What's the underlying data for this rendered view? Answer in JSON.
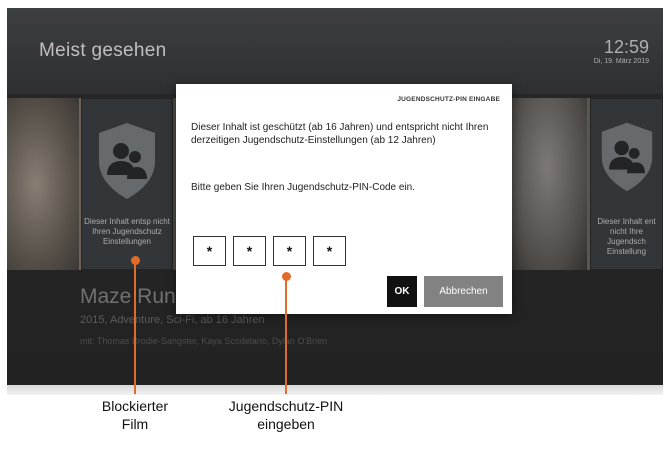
{
  "screen": {
    "page_title": "Meist gesehen",
    "clock_time": "12:59",
    "clock_date": "Di, 19. März 2019"
  },
  "carousel": {
    "left_tile_text": "Dieser Inhalt entsp nicht Ihren Jugendschutz Einstellungen",
    "right_tile_text": "Dieser Inhalt ent nicht Ihre Jugendsch Einstellung",
    "selected_title": "Maze Runner",
    "selected_meta": "2015, Adventure, Sci-Fi, ab 16 Jahren",
    "selected_cast": "mit: Thomas Brodie-Sangster, Kaya Scodelario, Dylan O'Brien"
  },
  "dialog": {
    "title": "JUGENDSCHUTZ-PIN EINGABE",
    "message": "Dieser Inhalt ist geschützt (ab 16 Jahren) und entspricht nicht Ihren derzeitigen Jugendschutz-Einstellungen (ab 12 Jahren)",
    "prompt": "Bitte geben Sie Ihren Jugendschutz-PIN-Code ein.",
    "pin_digits": [
      "*",
      "*",
      "*",
      "*"
    ],
    "ok_label": "OK",
    "cancel_label": "Abbrechen"
  },
  "annotations": {
    "blocked_line1": "Blockierter",
    "blocked_line2": "Film",
    "pin_line1": "Jugendschutz-PIN",
    "pin_line2": "eingeben"
  },
  "colors": {
    "callout": "#e36b2a",
    "ok_button": "#111111",
    "cancel_button": "#828282"
  }
}
